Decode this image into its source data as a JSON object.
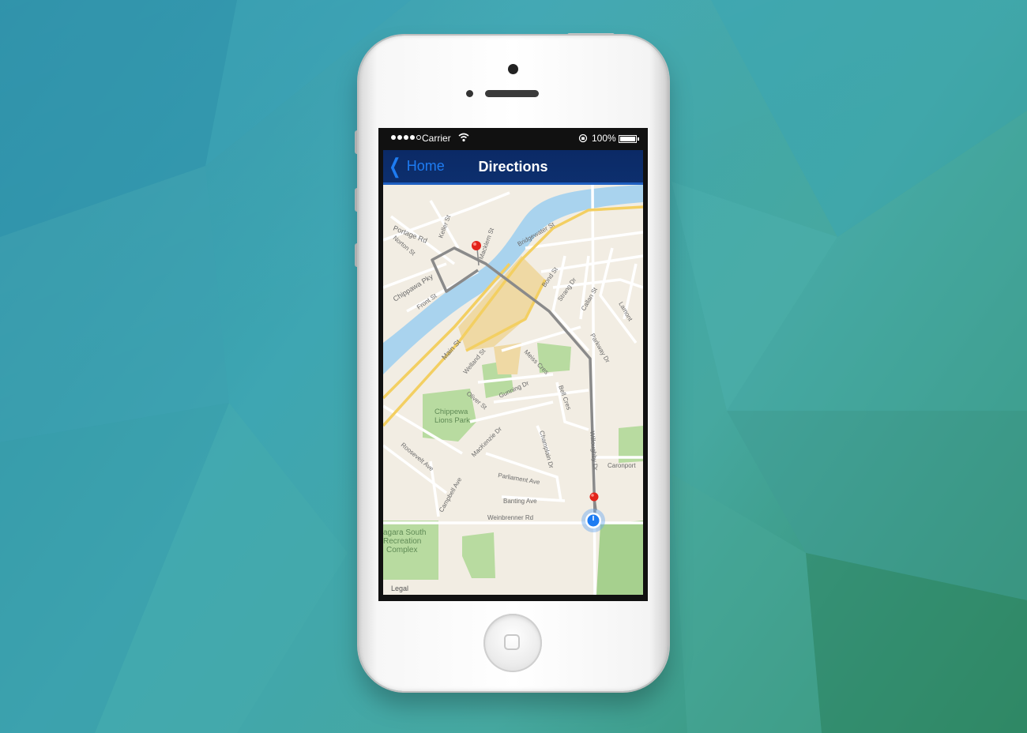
{
  "status_bar": {
    "carrier": "Carrier",
    "battery": "100%"
  },
  "nav": {
    "back_label": "Home",
    "title": "Directions"
  },
  "map": {
    "legal": "Legal",
    "labels": {
      "portage": "Portage Rd",
      "norton": "Norton St",
      "keller": "Keller St",
      "macklem": "Macklem St",
      "bridgewater": "Bridgewater St",
      "chippawa_pky": "Chippawa Pky",
      "front": "Front St",
      "main": "Main St",
      "bond": "Bond St",
      "strang": "Strang Dr",
      "callan": "Callan St",
      "lamont": "Lamont",
      "parkway": "Parkway Dr",
      "welland": "Welland St",
      "meiss": "Meiss Cres",
      "oliver": "Oliver St",
      "gunning": "Gunning Dr",
      "bell": "Bell Cres",
      "park_line1": "Chippewa",
      "park_line2": "Lions Park",
      "mackenzie": "MacKenzie Dr",
      "champlain": "Champlain Dr",
      "willoughby": "Willoughby Dr",
      "caronport": "Caronport",
      "roosevelt": "Roosevelt Ave",
      "parliament": "Parliament Ave",
      "campbell": "Campbell Ave",
      "banting": "Banting Ave",
      "weinbrenner": "Weinbrenner Rd",
      "rec_line1": "agara South",
      "rec_line2": "Recreation",
      "rec_line3": "Complex"
    }
  },
  "colors": {
    "nav_bg": "#0d2f6e",
    "accent": "#1e7cf2",
    "river": "#a9d3ee",
    "park": "#b8dba0",
    "major_road": "#f3cf62",
    "route": "#8a8a8a",
    "pin": "#e2231a"
  },
  "icons": {
    "back": "chevron-left-icon",
    "wifi": "wifi-icon",
    "lock": "orientation-lock-icon",
    "battery": "battery-icon",
    "pin": "map-pin-icon",
    "location": "current-location-icon"
  }
}
